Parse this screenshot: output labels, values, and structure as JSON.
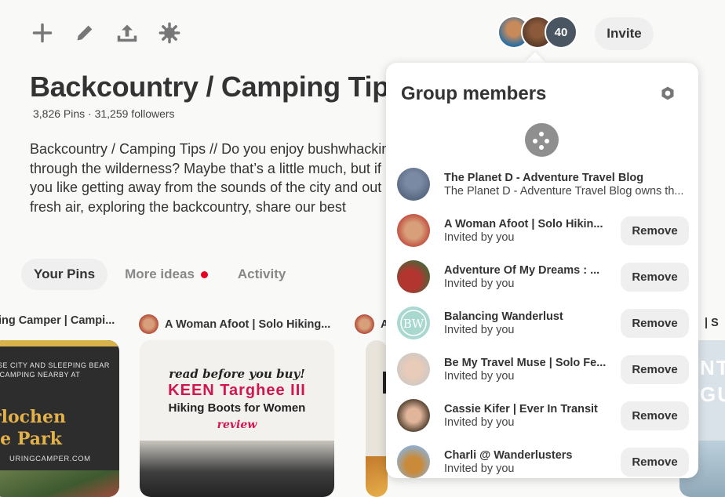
{
  "toolbar": {
    "icons": [
      "plus-icon",
      "pencil-icon",
      "share-icon",
      "settings-icon"
    ]
  },
  "header": {
    "member_count": "40",
    "invite_label": "Invite"
  },
  "board": {
    "title": "Backcountry / Camping Tips",
    "stats": "3,826 Pins · 31,259 followers",
    "description": "Backcountry / Camping Tips // Do you enjoy bushwhacking through the wilderness? Maybe that’s a little much, but if you like getting away from the sounds of the city and out in fresh air, exploring the backcountry, share our best backcountry experiences"
  },
  "tabs": [
    {
      "label": "Your Pins",
      "active": true
    },
    {
      "label": "More ideas",
      "active": false,
      "notification": true
    },
    {
      "label": "Activity",
      "active": false
    }
  ],
  "pins": [
    {
      "author": "ing Camper | Campi...",
      "lines": [
        "RSE CITY AND SLEEPING BEAR",
        "E CAMPING NEARBY AT",
        "rlochen",
        "te Park",
        "URINGCAMPER.COM"
      ]
    },
    {
      "author": "A Woman Afoot | Solo Hiking...",
      "lines": [
        "read before you buy!",
        "KEEN Targhee III",
        "Hiking Boots for Women",
        "review"
      ]
    },
    {
      "author": "A"
    },
    {
      "author": "| S",
      "lines": [
        "NTE",
        "GUI"
      ]
    }
  ],
  "modal": {
    "title": "Group members",
    "members": [
      {
        "name": "The Planet D - Adventure Travel Blog",
        "sub": "The Planet D - Adventure Travel Blog owns th...",
        "removable": false,
        "color": "#6d7f9a"
      },
      {
        "name": "A Woman Afoot | Solo Hikin...",
        "sub": "Invited by you",
        "removable": true,
        "color": "#c04a3c"
      },
      {
        "name": "Adventure Of My Dreams : ...",
        "sub": "Invited by you",
        "removable": true,
        "color": "#b3352f"
      },
      {
        "name": "Balancing Wanderlust",
        "sub": "Invited by you",
        "removable": true,
        "color": "#a8d8d0"
      },
      {
        "name": "Be My Travel Muse | Solo Fe...",
        "sub": "Invited by you",
        "removable": true,
        "color": "#d9b8a6"
      },
      {
        "name": "Cassie Kifer | Ever In Transit",
        "sub": "Invited by you",
        "removable": true,
        "color": "#6b4a3a"
      },
      {
        "name": "Charli @ Wanderlusters",
        "sub": "Invited by you",
        "removable": true,
        "color": "#c98a3a"
      }
    ],
    "remove_label": "Remove"
  }
}
